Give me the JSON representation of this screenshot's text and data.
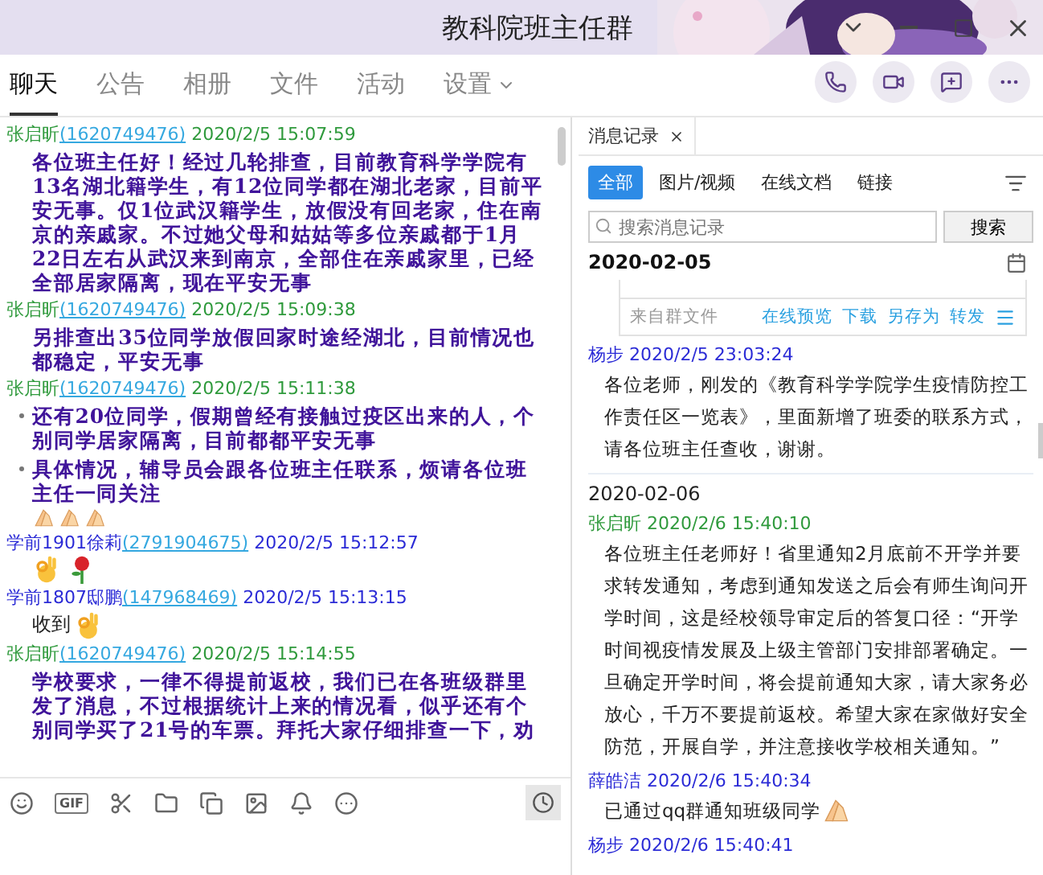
{
  "window": {
    "title": "教科院班主任群"
  },
  "tabs": [
    {
      "label": "聊天",
      "selected": true,
      "kind": "plain"
    },
    {
      "label": "公告",
      "selected": false,
      "kind": "plain"
    },
    {
      "label": "相册",
      "selected": false,
      "kind": "plain"
    },
    {
      "label": "文件",
      "selected": false,
      "kind": "plain"
    },
    {
      "label": "活动",
      "selected": false,
      "kind": "plain"
    },
    {
      "label": "设置",
      "selected": false,
      "kind": "menu"
    }
  ],
  "chat": {
    "messages": [
      {
        "sender": "张启昕",
        "qq": "(1620749476)",
        "time": "2020/2/5 15:07:59",
        "color": "#2f9a3c",
        "kind": "styled",
        "text": "各位班主任好！经过几轮排查，目前教育科学学院有13名湖北籍学生，有12位同学都在湖北老家，目前平安无事。仅1位武汉籍学生，放假没有回老家，住在南京的亲戚家。不过她父母和姑姑等多位亲戚都于1月22日左右从武汉来到南京，全部住在亲戚家里，已经全部居家隔离，现在平安无事"
      },
      {
        "sender": "张启昕",
        "qq": "(1620749476)",
        "time": "2020/2/5 15:09:38",
        "color": "#2f9a3c",
        "kind": "styled",
        "text": "另排查出35位同学放假回家时途经湖北，目前情况也都稳定，平安无事"
      },
      {
        "sender": "张启昕",
        "qq": "(1620749476)",
        "time": "2020/2/5 15:11:38",
        "color": "#2f9a3c",
        "kind": "bullets",
        "bullets": [
          {
            "text": "还有20位同学，假期曾经有接触过疫区出来的人，个别同学居家隔离，目前都都平安无事"
          },
          {
            "text": "具体情况，辅导员会跟各位班主任联系，烦请各位班主任一同关注",
            "stickers": [
              {
                "kind": "hands"
              },
              {
                "kind": "hands"
              },
              {
                "kind": "hands"
              }
            ]
          }
        ]
      },
      {
        "sender": "学前1901徐莉",
        "qq": "(2791904675)",
        "time": "2020/2/5 15:12:57",
        "color": "#2b2bd6",
        "kind": "stickers",
        "stickers": [
          {
            "kind": "ok"
          },
          {
            "kind": "rose"
          }
        ]
      },
      {
        "sender": "学前1807邸鹏",
        "qq": "(147968469)",
        "time": "2020/2/5 15:13:15",
        "color": "#2b2bd6",
        "kind": "plain",
        "text": "收到",
        "stickers": [
          {
            "kind": "ok"
          }
        ]
      },
      {
        "sender": "张启昕",
        "qq": "(1620749476)",
        "time": "2020/2/5 15:14:55",
        "color": "#2f9a3c",
        "kind": "styled",
        "text": "学校要求，一律不得提前返校，我们已在各班级群里发了消息，不过根据统计上来的情况看，似乎还有个别同学买了21号的车票。拜托大家仔细排查一下，劝"
      }
    ]
  },
  "toolbar": {
    "gif_label": "GIF"
  },
  "history": {
    "tab_label": "消息记录",
    "filters": [
      {
        "label": "全部",
        "selected": true
      },
      {
        "label": "图片/视频",
        "selected": false
      },
      {
        "label": "在线文档",
        "selected": false
      },
      {
        "label": "链接",
        "selected": false
      }
    ],
    "search": {
      "placeholder": "搜索消息记录",
      "button": "搜索"
    },
    "pinned_date": "2020-02-05",
    "entries": [
      {
        "kind": "file_card",
        "source": "来自群文件",
        "actions": [
          "在线预览",
          "下载",
          "另存为",
          "转发"
        ]
      },
      {
        "kind": "message",
        "sender": "杨步",
        "time": "2020/2/5 23:03:24",
        "color": "#2b2bd6",
        "text": "各位老师，刚发的《教育科学学院学生疫情防控工作责任区一览表》，里面新增了班委的联系方式，请各位班主任查收，谢谢。"
      },
      {
        "kind": "date",
        "date": "2020-02-06"
      },
      {
        "kind": "message",
        "sender": "张启昕",
        "time": "2020/2/6 15:40:10",
        "color": "#2f9a3c",
        "text": "各位班主任老师好！省里通知2月底前不开学并要求转发通知，考虑到通知发送之后会有师生询问开学时间，这是经校领导审定后的答复口径：“开学时间视疫情发展及上级主管部门安排部署确定。一旦确定开学时间，将会提前通知大家，请大家务必放心，千万不要提前返校。希望大家在家做好安全防范，开展自学，并注意接收学校相关通知。”"
      },
      {
        "kind": "message",
        "sender": "薛皓洁",
        "time": "2020/2/6 15:40:34",
        "color": "#2b2bd6",
        "text": "已通过qq群通知班级同学",
        "stickers": [
          {
            "kind": "hands"
          }
        ]
      },
      {
        "kind": "message",
        "sender": "杨步",
        "time": "2020/2/6 15:40:41",
        "color": "#2b2bd6"
      }
    ]
  }
}
